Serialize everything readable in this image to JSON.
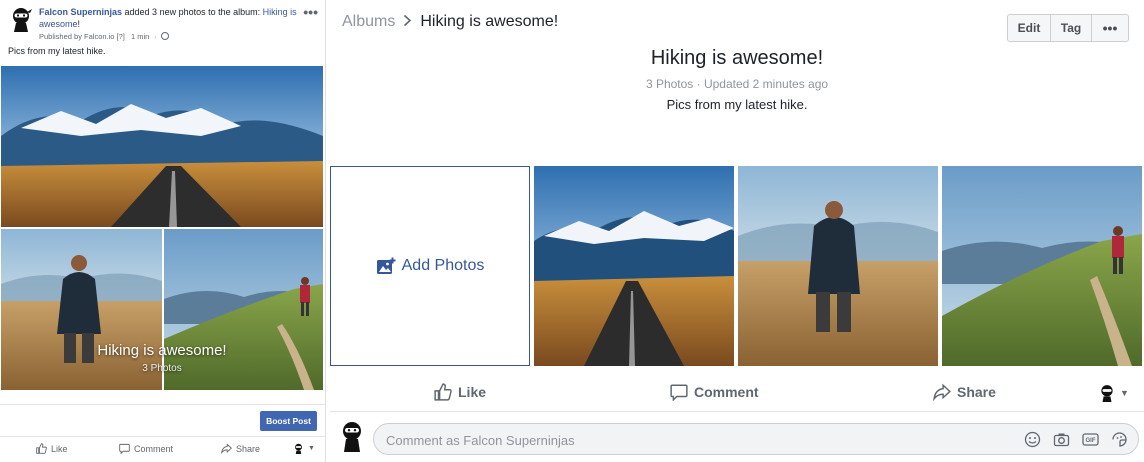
{
  "post": {
    "page_name": "Falcon Superninjas",
    "action_text": " added 3 new photos to the album: ",
    "album_link": "Hiking is awesome",
    "album_link_end": "!",
    "published_by": "Published by Falcon.io [?]",
    "time": "1 min",
    "more": "•••",
    "caption": "Pics from my latest hike.",
    "overlay_title": "Hiking is awesome!",
    "overlay_count": "3 Photos",
    "boost_label": "Boost Post",
    "actions": {
      "like": "Like",
      "comment": "Comment",
      "share": "Share"
    }
  },
  "album": {
    "breadcrumb_root": "Albums",
    "breadcrumb_sep": ">",
    "breadcrumb_current": "Hiking is awesome!",
    "buttons": {
      "edit": "Edit",
      "tag": "Tag",
      "more": "•••"
    },
    "title": "Hiking is awesome!",
    "meta": "3 Photos · Updated 2 minutes ago",
    "description": "Pics from my latest hike.",
    "add_photos_label": "Add Photos",
    "actions": {
      "like": "Like",
      "comment": "Comment",
      "share": "Share"
    },
    "comment_placeholder": "Comment as Falcon Superninjas"
  },
  "colors": {
    "link": "#365899",
    "boost": "#4267b2",
    "muted": "#90949c",
    "text": "#1d2129"
  },
  "icons": [
    "ninja-avatar-icon",
    "globe-icon",
    "more-icon",
    "add-photo-icon",
    "like-icon",
    "comment-icon",
    "share-icon",
    "caret-down-icon",
    "emoji-icon",
    "camera-icon",
    "gif-icon",
    "sticker-icon"
  ]
}
